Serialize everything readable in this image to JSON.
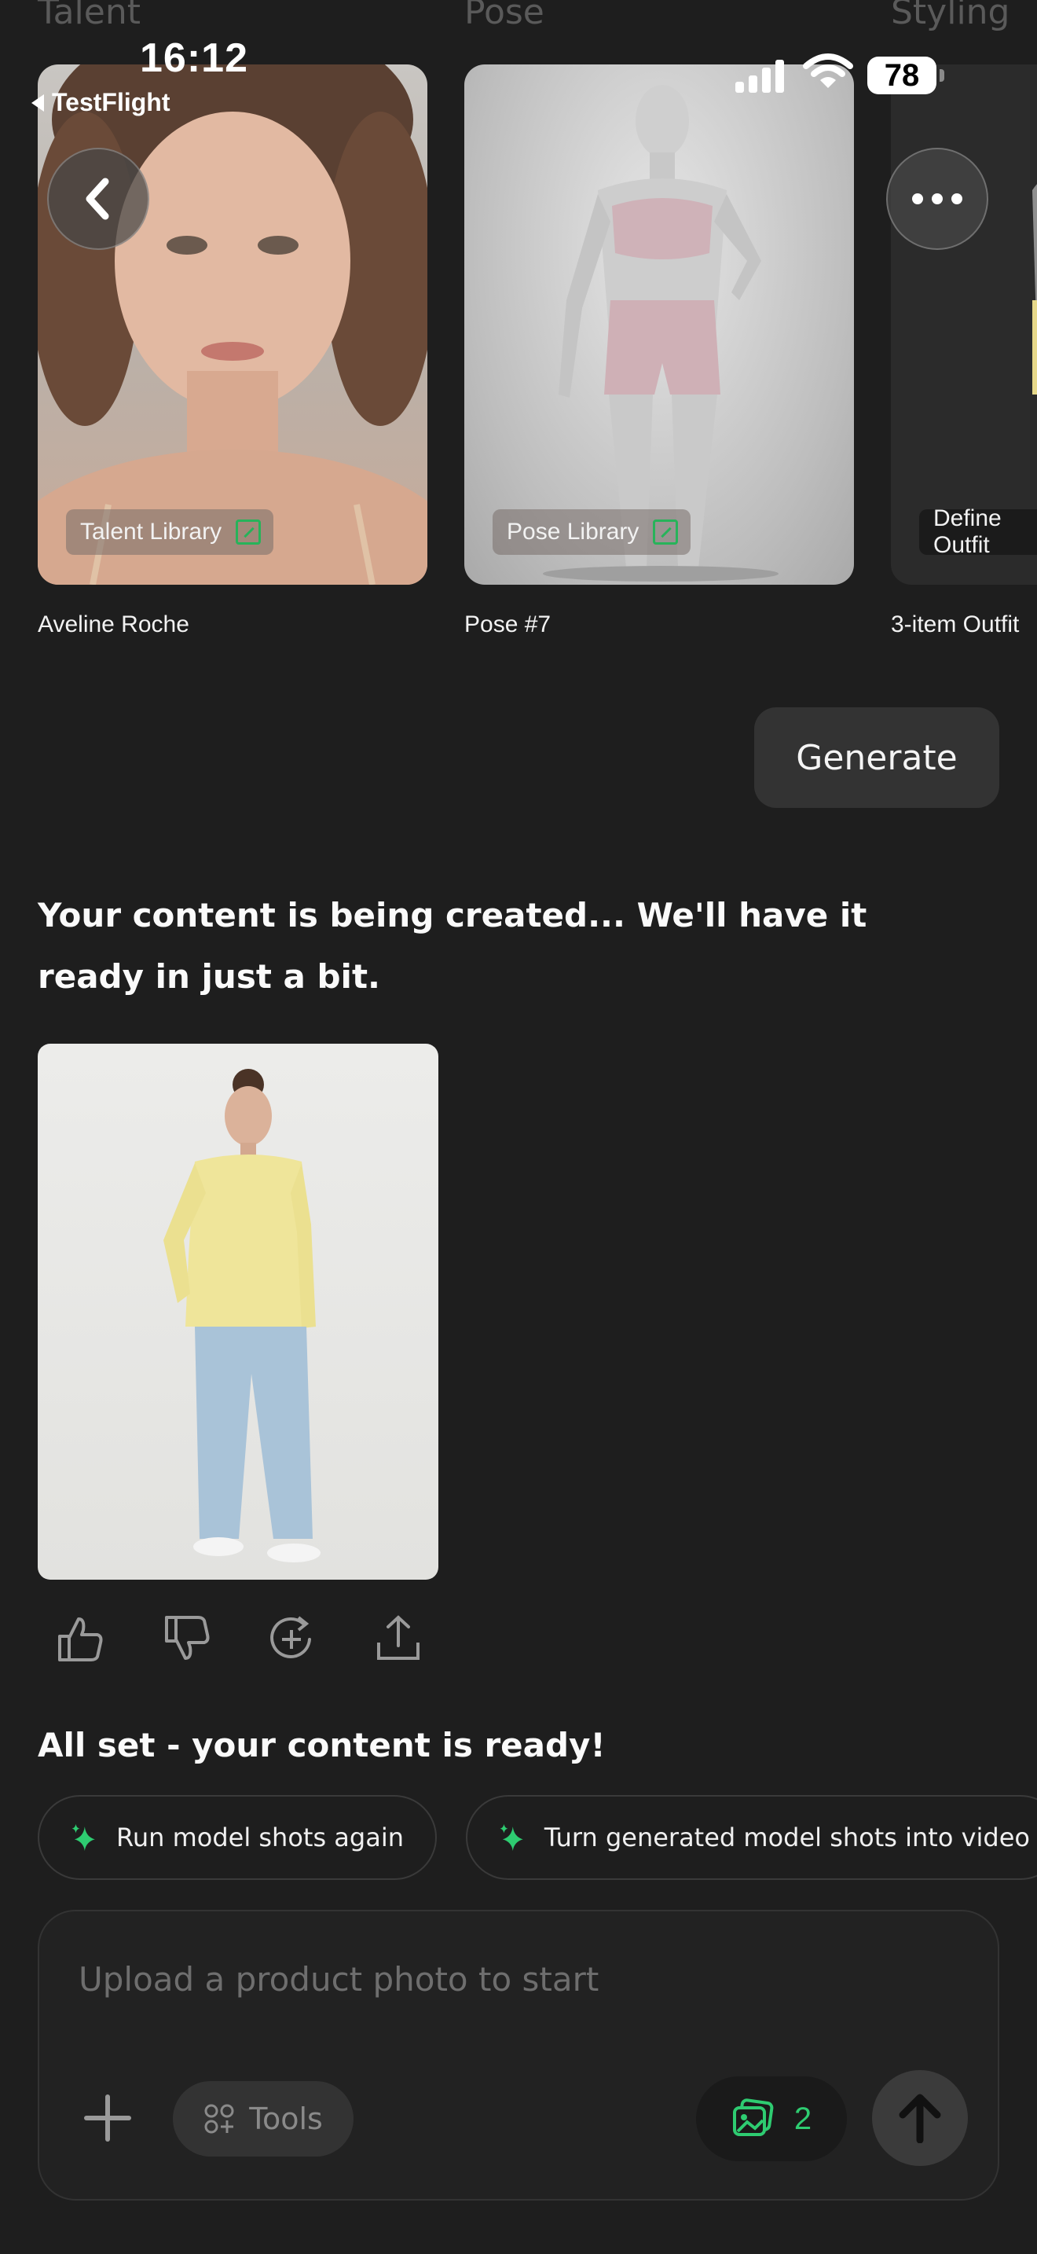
{
  "status_bar": {
    "time": "16:12",
    "back_app": "TestFlight",
    "battery": "78"
  },
  "strip": {
    "labels": [
      "Talent",
      "Pose",
      "Styling"
    ],
    "cards": [
      {
        "chip": "Talent Library",
        "caption": "Aveline Roche"
      },
      {
        "chip": "Pose Library",
        "caption": "Pose #7"
      },
      {
        "chip": "Define Outfit",
        "caption": "3-item Outfit"
      }
    ]
  },
  "generate_label": "Generate",
  "messages": {
    "creating": "Your content is being created... We'll have it ready in just a bit.",
    "ready": "All set - your content is ready!"
  },
  "suggestions": [
    "Run model shots again",
    "Turn generated model shots into video"
  ],
  "composer": {
    "placeholder": "Upload a product photo to start",
    "tools_label": "Tools",
    "image_count": "2"
  },
  "colors": {
    "background": "#1e1e1e",
    "accent_green": "#2ecc71"
  }
}
